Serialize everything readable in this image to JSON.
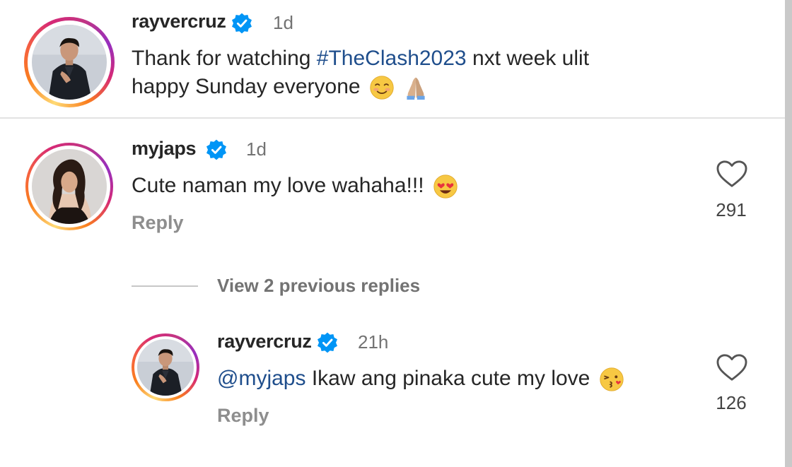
{
  "caption": {
    "username": "rayvercruz",
    "time": "1d",
    "line1_prefix": "Thank for watching ",
    "hashtag": "#TheClash2023",
    "line1_suffix": " nxt week ulit",
    "line2": "happy Sunday everyone",
    "emojis": [
      "smiling-blush-emoji",
      "folded-hands-emoji"
    ]
  },
  "comment": {
    "username": "myjaps",
    "time": "1d",
    "text": "Cute naman my love wahaha!!!",
    "emoji": "heart-eyes-emoji",
    "reply_label": "Reply",
    "likes": "291"
  },
  "view_replies_label": "View 2 previous replies",
  "reply": {
    "username": "rayvercruz",
    "time": "21h",
    "mention": "@myjaps",
    "text": " Ikaw ang pinaka cute my love",
    "emoji": "kissing-heart-emoji",
    "reply_label": "Reply",
    "likes": "126"
  },
  "colors": {
    "verified": "#0095f6",
    "link": "#1f4e8c",
    "muted": "#8e8e8e",
    "text": "#262626"
  }
}
